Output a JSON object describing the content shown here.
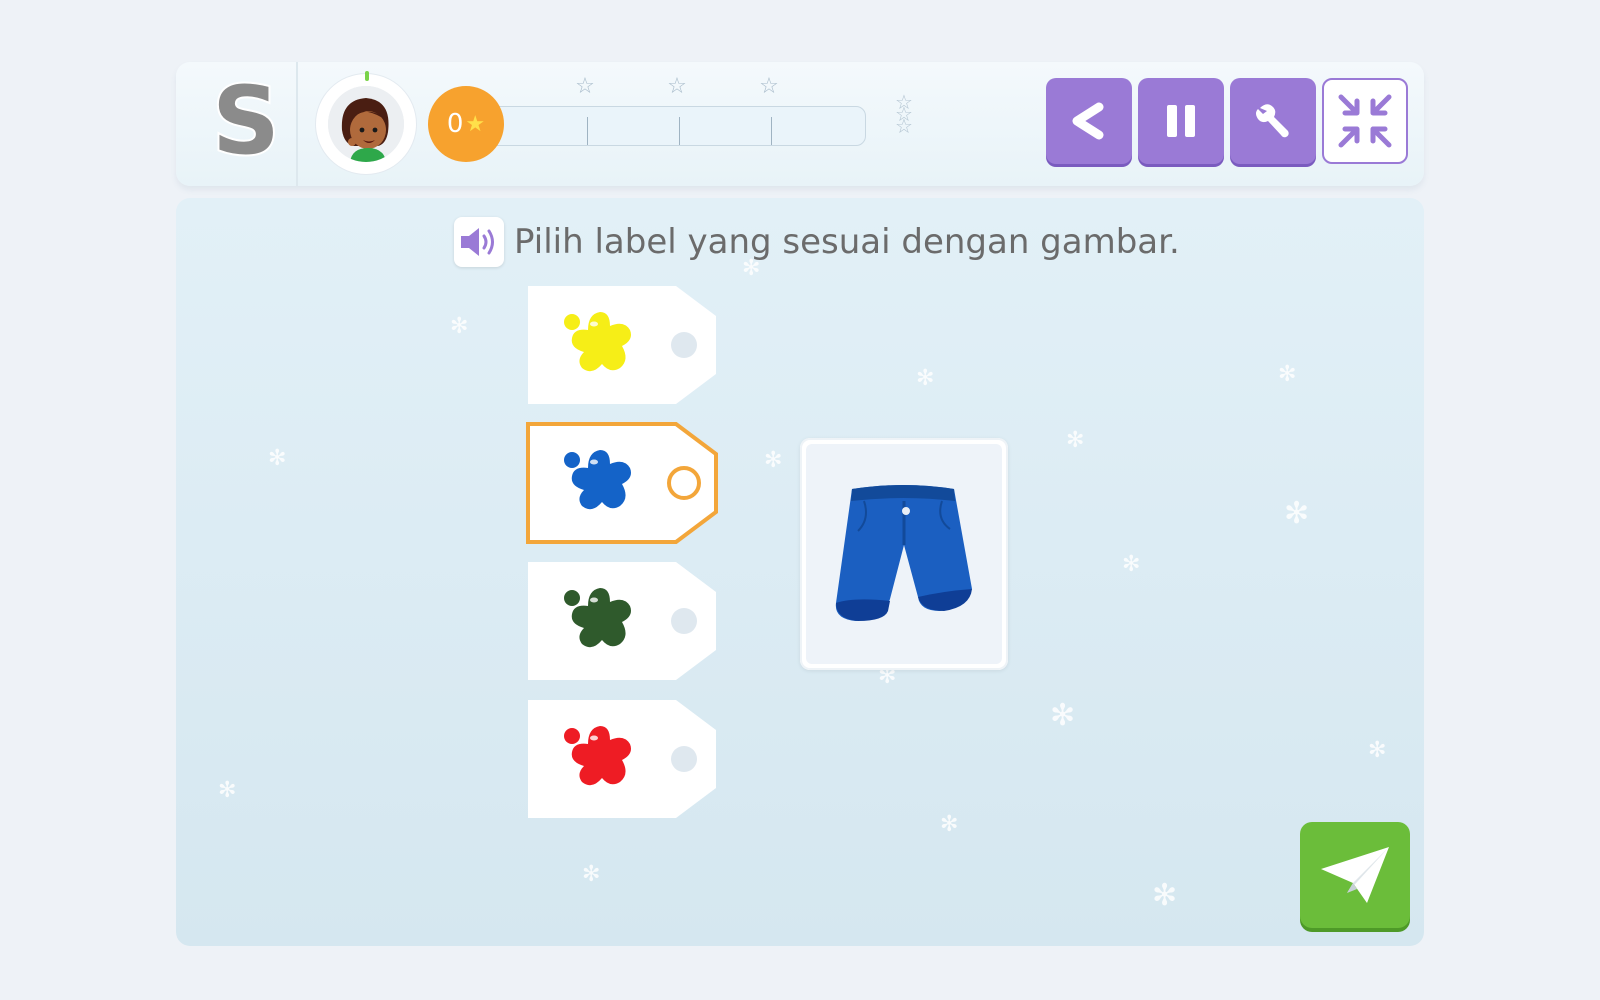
{
  "header": {
    "logo_letter": "S",
    "score": "0",
    "progress_segments": 4,
    "milestone_stars": 3,
    "buttons": [
      {
        "name": "back",
        "icon": "chevron-left-icon"
      },
      {
        "name": "pause",
        "icon": "pause-icon"
      },
      {
        "name": "settings",
        "icon": "wrench-icon"
      },
      {
        "name": "exit-fullscreen",
        "icon": "collapse-arrows-icon"
      }
    ]
  },
  "question": {
    "instruction": "Pilih label yang sesuai dengan gambar.",
    "audio_icon": "speaker-icon"
  },
  "options": [
    {
      "color_name": "yellow",
      "color": "#f6ee17",
      "selected": false
    },
    {
      "color_name": "blue",
      "color": "#1463c8",
      "selected": true
    },
    {
      "color_name": "dark-green",
      "color": "#2f5a2c",
      "selected": false
    },
    {
      "color_name": "red",
      "color": "#ee1c24",
      "selected": false
    }
  ],
  "picture": {
    "subject": "blue shorts",
    "color": "#1b5fc1"
  },
  "colors": {
    "accent_purple": "#9a7ad6",
    "score_orange": "#f7a22e",
    "selected_outline": "#f3a63a",
    "submit_green": "#6bbd3a"
  }
}
